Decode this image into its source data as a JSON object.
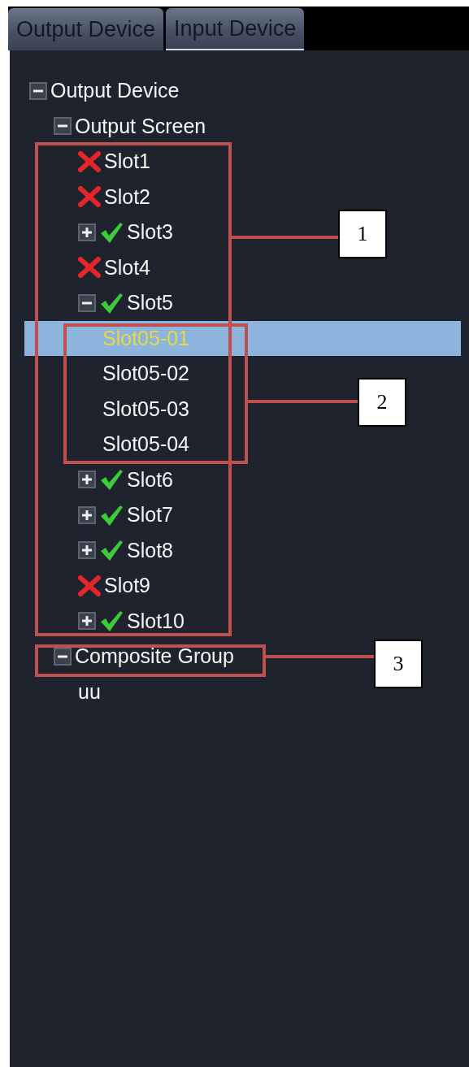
{
  "tabs": [
    {
      "label": "Output Device",
      "selected": true
    },
    {
      "label": "Input Device",
      "selected": false
    }
  ],
  "tree": [
    {
      "label": "Output Device",
      "expanded": true,
      "selected": false,
      "children": [
        {
          "label": "Output Screen",
          "expanded": true,
          "selected": false,
          "children": [
            {
              "label": "Slot1",
              "ok": false,
              "selected": false
            },
            {
              "label": "Slot2",
              "ok": false,
              "selected": false
            },
            {
              "label": "Slot3",
              "ok": true,
              "expanded": false,
              "selected": false
            },
            {
              "label": "Slot4",
              "ok": false,
              "selected": false
            },
            {
              "label": "Slot5",
              "ok": true,
              "expanded": true,
              "selected": false,
              "children": [
                {
                  "label": "Slot05-01",
                  "selected": true
                },
                {
                  "label": "Slot05-02",
                  "selected": false
                },
                {
                  "label": "Slot05-03",
                  "selected": false
                },
                {
                  "label": "Slot05-04",
                  "selected": false
                }
              ]
            },
            {
              "label": "Slot6",
              "ok": true,
              "expanded": false,
              "selected": false
            },
            {
              "label": "Slot7",
              "ok": true,
              "expanded": false,
              "selected": false
            },
            {
              "label": "Slot8",
              "ok": true,
              "expanded": false,
              "selected": false
            },
            {
              "label": "Slot9",
              "ok": false,
              "selected": false
            },
            {
              "label": "Slot10",
              "ok": true,
              "expanded": false,
              "selected": false
            }
          ]
        },
        {
          "label": "Composite Group",
          "expanded": true,
          "selected": false,
          "children": [
            {
              "label": "uu",
              "selected": false
            }
          ]
        }
      ]
    }
  ],
  "callouts": [
    {
      "label": "1"
    },
    {
      "label": "2"
    },
    {
      "label": "3"
    }
  ]
}
